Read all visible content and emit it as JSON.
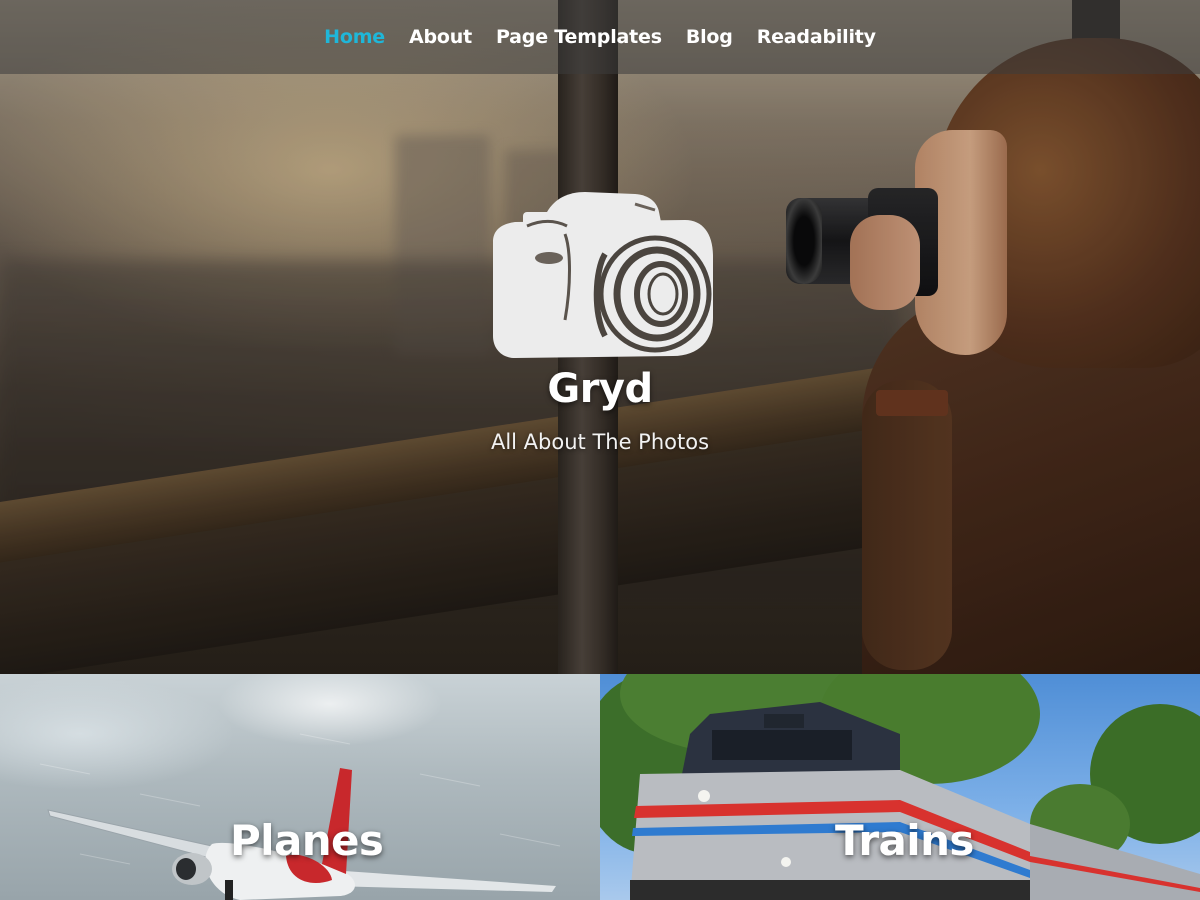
{
  "nav": {
    "items": [
      {
        "label": "Home",
        "active": true
      },
      {
        "label": "About",
        "active": false
      },
      {
        "label": "Page Templates",
        "active": false
      },
      {
        "label": "Blog",
        "active": false
      },
      {
        "label": "Readability",
        "active": false
      }
    ]
  },
  "branding": {
    "logo_icon": "camera-icon",
    "title": "Gryd",
    "description": "All About The Photos"
  },
  "tiles": [
    {
      "title": "Planes"
    },
    {
      "title": "Trains"
    }
  ],
  "colors": {
    "nav_active": "#1fb7d9",
    "nav_text": "#ffffff",
    "text": "#ffffff"
  }
}
